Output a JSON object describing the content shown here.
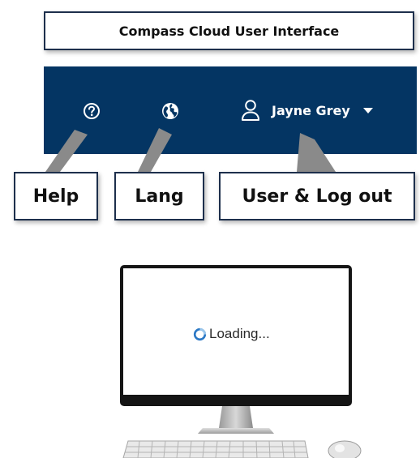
{
  "title": "Compass Cloud User Interface",
  "header": {
    "background_color": "#043563",
    "help_icon": "help-question-circle-icon",
    "lang_icon": "globe-icon",
    "user_icon": "user-person-icon",
    "user_name": "Jayne Grey",
    "dropdown_icon": "caret-down-icon"
  },
  "callouts": {
    "help": "Help",
    "lang": "Lang",
    "user": "User & Log out"
  },
  "monitor": {
    "loading_text": "Loading...",
    "spinner_icon": "loading-spinner-icon",
    "spinner_color": "#2b78c5"
  }
}
